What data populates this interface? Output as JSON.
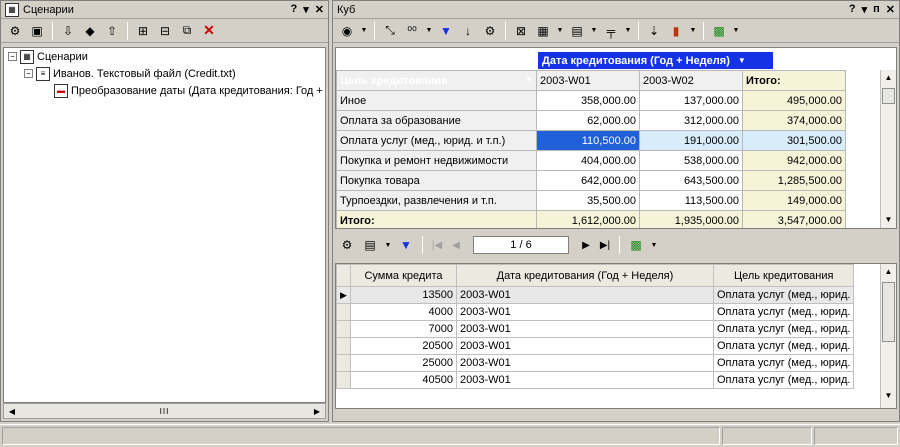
{
  "left_pane": {
    "title": "Сценарии",
    "controls": {
      "help": "?",
      "menu": "▾",
      "close": "✕"
    },
    "tree": [
      {
        "label": "Сценарии",
        "level": 0
      },
      {
        "label": "Иванов. Текстовый файл (Credit.txt)",
        "level": 1
      },
      {
        "label": "Преобразование даты (Дата кредитования: Год +",
        "level": 2
      }
    ],
    "scroll_thumb": "III"
  },
  "right_pane": {
    "title": "Куб",
    "controls": {
      "help": "?",
      "menu": "▾",
      "pin": "ᴨ",
      "close": "✕"
    },
    "column_dimension": "Дата кредитования (Год + Неделя)",
    "row_dimension": "Цель кредитования",
    "columns": [
      "2003-W01",
      "2003-W02",
      "Итого:"
    ],
    "rows": [
      {
        "label": "Иное",
        "values": [
          "358,000.00",
          "137,000.00",
          "495,000.00"
        ]
      },
      {
        "label": "Оплата за образование",
        "values": [
          "62,000.00",
          "312,000.00",
          "374,000.00"
        ]
      },
      {
        "label": "Оплата услуг (мед., юрид. и т.п.)",
        "values": [
          "110,500.00",
          "191,000.00",
          "301,500.00"
        ]
      },
      {
        "label": "Покупка и ремонт недвижимости",
        "values": [
          "404,000.00",
          "538,000.00",
          "942,000.00"
        ]
      },
      {
        "label": "Покупка товара",
        "values": [
          "642,000.00",
          "643,500.00",
          "1,285,500.00"
        ]
      },
      {
        "label": "Турпоездки, развлечения и т.п.",
        "values": [
          "35,500.00",
          "113,500.00",
          "149,000.00"
        ]
      }
    ],
    "total": {
      "label": "Итого:",
      "values": [
        "1,612,000.00",
        "1,935,000.00",
        "3,547,000.00"
      ]
    },
    "pager": "1 / 6",
    "detail_columns": [
      "Сумма кредита",
      "Дата кредитования (Год + Неделя)",
      "Цель кредитования"
    ],
    "detail_rows": [
      {
        "amount": "13500",
        "date": "2003-W01",
        "purpose": "Оплата услуг (мед., юрид."
      },
      {
        "amount": "4000",
        "date": "2003-W01",
        "purpose": "Оплата услуг (мед., юрид."
      },
      {
        "amount": "7000",
        "date": "2003-W01",
        "purpose": "Оплата услуг (мед., юрид."
      },
      {
        "amount": "20500",
        "date": "2003-W01",
        "purpose": "Оплата услуг (мед., юрид."
      },
      {
        "amount": "25000",
        "date": "2003-W01",
        "purpose": "Оплата услуг (мед., юрид."
      },
      {
        "amount": "40500",
        "date": "2003-W01",
        "purpose": "Оплата услуг (мед., юрид."
      }
    ]
  },
  "colors": {
    "accent": "#1632e6",
    "selection": "#2060d8",
    "total_bg": "#f5f3d8",
    "highlight": "#d8ecfa"
  }
}
